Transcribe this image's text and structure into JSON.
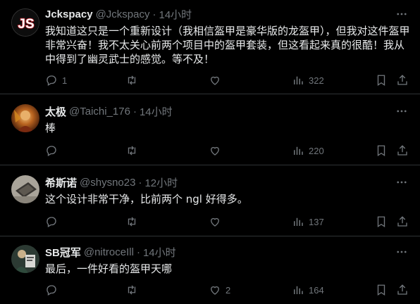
{
  "tweets": [
    {
      "name": "Jckspacy",
      "handle": "@Jckspacy",
      "time": "14小时",
      "text": "我知道这只是一个重新设计（我相信盔甲是豪华版的龙盔甲），但我对这件盔甲非常兴奋！我不太关心前两个项目中的盔甲套装，但这看起来真的很酷！我从中得到了幽灵武士的感觉。等不及！",
      "reply_count": "1",
      "retweet_count": "",
      "like_count": "",
      "views_count": "322",
      "avatar_text": "JS"
    },
    {
      "name": "太极",
      "handle": "@Taichi_176",
      "time": "14小时",
      "text": "棒",
      "reply_count": "",
      "retweet_count": "",
      "like_count": "",
      "views_count": "220"
    },
    {
      "name": "希斯诺",
      "handle": "@shysno23",
      "time": "12小时",
      "text": "这个设计非常干净，比前两个 ngl 好得多。",
      "reply_count": "",
      "retweet_count": "",
      "like_count": "",
      "views_count": "137"
    },
    {
      "name": "SB冠军",
      "handle": "@nitroceIll",
      "time": "14小时",
      "text": "最后，一件好看的盔甲天哪",
      "reply_count": "",
      "retweet_count": "",
      "like_count": "2",
      "views_count": "164"
    }
  ],
  "separator": "·",
  "colors": {
    "background": "#000000",
    "text": "#e7e9ea",
    "muted": "#71767b",
    "border": "#2f3336"
  },
  "icons": [
    "more-icon",
    "reply-icon",
    "retweet-icon",
    "like-icon",
    "views-icon",
    "bookmark-icon",
    "share-icon"
  ]
}
